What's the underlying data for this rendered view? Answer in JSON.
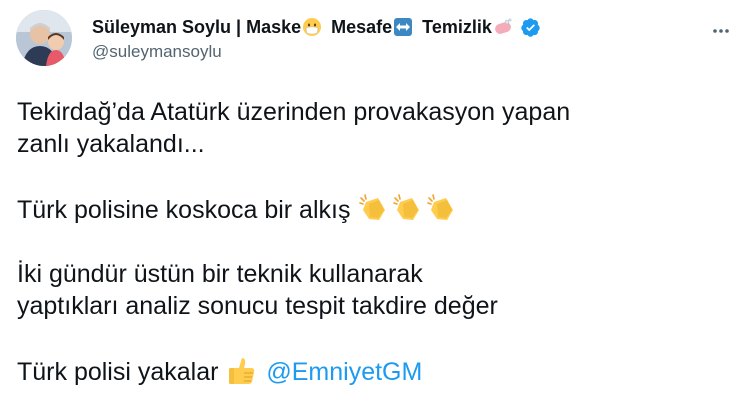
{
  "author": {
    "name_part1": "Süleyman Soylu | Maske",
    "name_part2": "Mesafe",
    "name_part3": "Temizlik",
    "handle": "@suleymansoylu",
    "verified": true
  },
  "tweet": {
    "line1": "Tekirdağ’da Atatürk üzerinden provakasyon yapan",
    "line2": "zanlı yakalandı...",
    "line3": "Türk polisine koskoca bir alkış",
    "line4": "İki gündür üstün bir teknik kullanarak",
    "line5": "yaptıkları analiz sonucu tespit takdire değer",
    "line6": "Türk polisi yakalar",
    "mention": "@EmniyetGM"
  },
  "icons": {
    "name_emojis": [
      "mask-emoji-icon",
      "left-right-arrow-emoji-icon",
      "soap-emoji-icon"
    ],
    "verified": "verified-badge-icon",
    "more": "more-options-icon",
    "clap": "clapping-hands-emoji-icon",
    "thumbs_up": "thumbs-up-emoji-icon"
  },
  "colors": {
    "text": "#0f1419",
    "secondary": "#536471",
    "accent": "#1d9bf0"
  }
}
